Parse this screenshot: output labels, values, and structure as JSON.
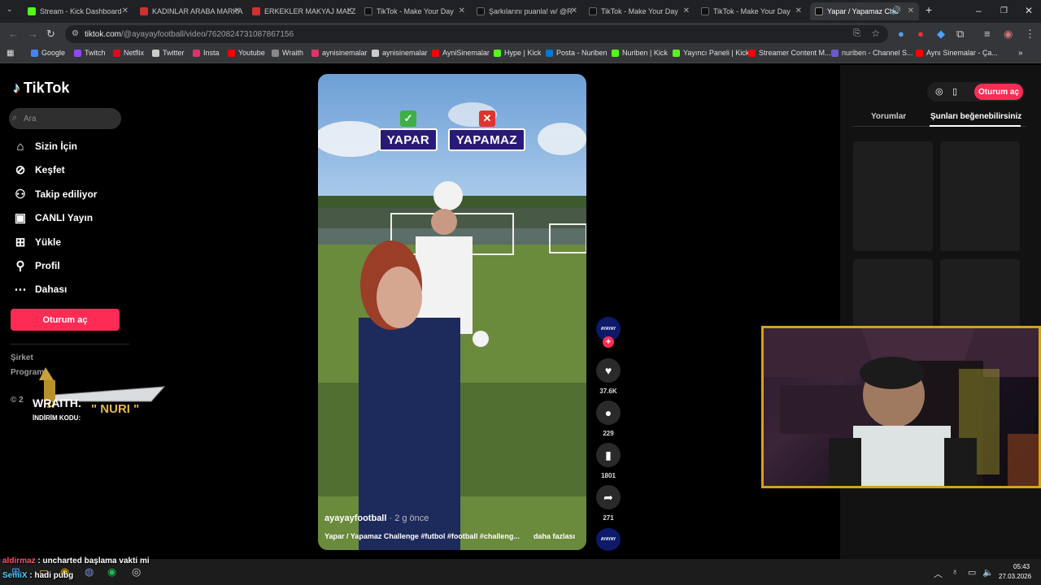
{
  "browser": {
    "tabs": [
      {
        "title": "Stream - Kick Dashboard",
        "fav_color": "#53fc18"
      },
      {
        "title": "KADINLAR ARABA MARKA",
        "fav_color": "#cc3333"
      },
      {
        "title": "ERKEKLER MAKYAJ MALZ",
        "fav_color": "#cc3333"
      },
      {
        "title": "TikTok - Make Your Day",
        "fav_color": "#111111"
      },
      {
        "title": "Şarkılarını puanla! w/ @R",
        "fav_color": "#111111"
      },
      {
        "title": "TikTok - Make Your Day",
        "fav_color": "#111111"
      },
      {
        "title": "TikTok - Make Your Day",
        "fav_color": "#111111"
      },
      {
        "title": "Yapar / Yapamaz Cha",
        "fav_color": "#111111"
      }
    ],
    "new_tab": "+",
    "url_host": "tiktok.com",
    "url_path": "/@ayayayfootball/video/7620824731087867156",
    "bookmarks": [
      {
        "label": "Google",
        "color": "#4285f4"
      },
      {
        "label": "Twitch",
        "color": "#9146ff"
      },
      {
        "label": "Netflix",
        "color": "#e50914"
      },
      {
        "label": "Twitter",
        "color": "#cccccc"
      },
      {
        "label": "Insta",
        "color": "#e1306c"
      },
      {
        "label": "Youtube",
        "color": "#ff0000"
      },
      {
        "label": "Wraith",
        "color": "#888888"
      },
      {
        "label": "aynisinemalar",
        "color": "#e1306c"
      },
      {
        "label": "aynisinemalar",
        "color": "#cccccc"
      },
      {
        "label": "AyniSinemalar",
        "color": "#ff0000"
      },
      {
        "label": "Hype | Kick",
        "color": "#53fc18"
      },
      {
        "label": "Posta - Nuriben",
        "color": "#0078d4"
      },
      {
        "label": "Nuriben | Kick",
        "color": "#53fc18"
      },
      {
        "label": "Yayıncı Paneli | Kick",
        "color": "#53fc18"
      },
      {
        "label": "Streamer Content M...",
        "color": "#ff0000"
      },
      {
        "label": "nuriben - Channel S...",
        "color": "#6a5acd"
      },
      {
        "label": "Aynı Sinemalar - Ça...",
        "color": "#ff0000"
      }
    ]
  },
  "tiktok": {
    "logo": "TikTok",
    "search_placeholder": "Ara",
    "nav": [
      {
        "label": "Sizin İçin",
        "icon": "home-icon"
      },
      {
        "label": "Keşfet",
        "icon": "compass-icon"
      },
      {
        "label": "Takip ediliyor",
        "icon": "following-icon"
      },
      {
        "label": "CANLI Yayın",
        "icon": "live-icon"
      },
      {
        "label": "Yükle",
        "icon": "upload-icon"
      },
      {
        "label": "Profil",
        "icon": "profile-icon"
      },
      {
        "label": "Dahası",
        "icon": "more-icon"
      }
    ],
    "login_button": "Oturum aç",
    "footer": [
      "Şirket",
      "Program"
    ],
    "footer_copy": "© 2",
    "video": {
      "badge_yes": "YAPAR",
      "badge_no": "YAPAMAZ",
      "username": "ayayayfootball",
      "ago": "· 2 g önce",
      "caption": "Yapar / Yapamaz Challenge #futbol #football #challeng...",
      "more": "daha fazlası"
    },
    "rail": {
      "avatar_text": "AYAYAY",
      "likes": "37.6K",
      "comments": "229",
      "saves": "1801",
      "shares": "271"
    },
    "right_panel": {
      "login": "Oturum aç",
      "tab_comments": "Yorumlar",
      "tab_suggestions": "Şunları beğenebilirsiniz"
    }
  },
  "overlay": {
    "brand": "WRAITH.",
    "code_label": "İNDİRİM KODU:",
    "code": "\" NURI \""
  },
  "chat": [
    {
      "user": "aldirmaz",
      "text": ": uncharted başlama vakti mi",
      "color": "#ff4d6d"
    },
    {
      "user": "SemiX",
      "text": ": hadi pubg",
      "color": "#4dd2ff"
    }
  ],
  "taskbar": {
    "time": "05:43",
    "date": "27.03.2026"
  }
}
